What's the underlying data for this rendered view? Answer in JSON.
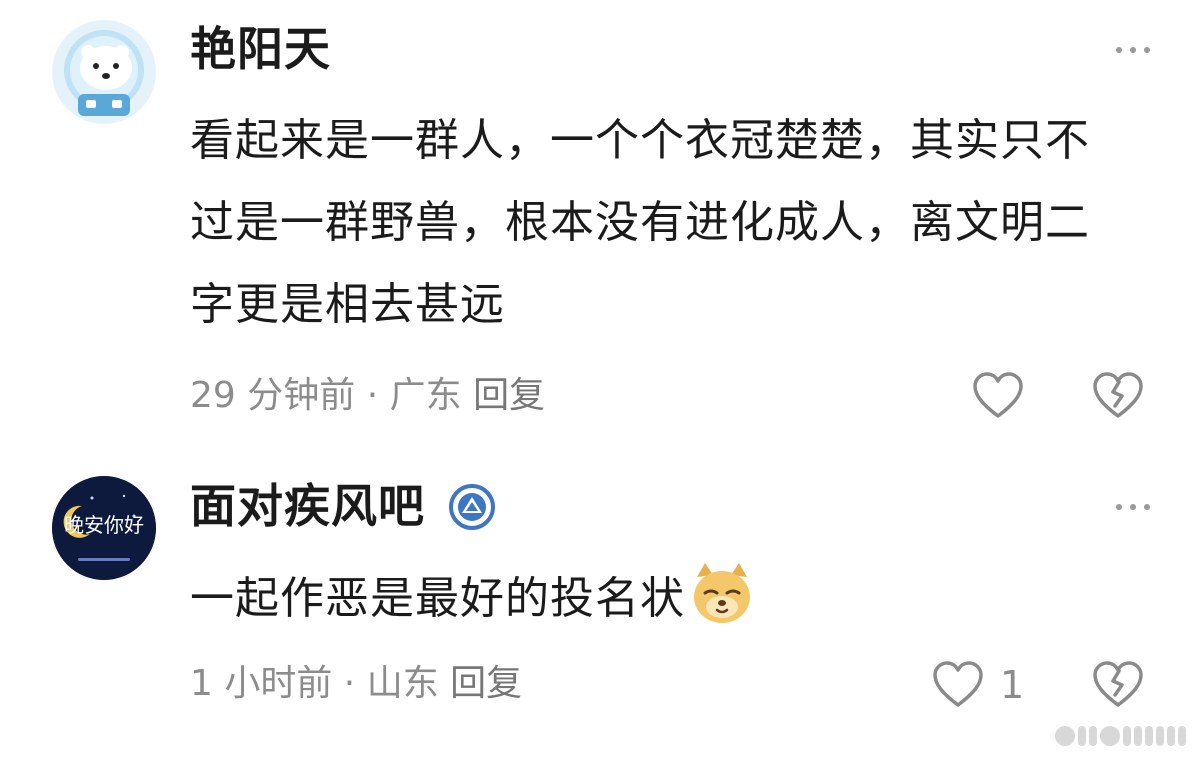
{
  "comments": [
    {
      "username": "艳阳天",
      "content": "看起来是一群人，一个个衣冠楚楚，其实只不过是一群野兽，根本没有进化成人，离文明二字更是相去甚远",
      "time": "29 分钟前",
      "location": "广东",
      "reply_label": "回复",
      "like_count": "",
      "avatar_icon": "polar-bear-astronaut-avatar",
      "colors": {
        "avatar_bg": "#eaf4fb"
      }
    },
    {
      "username": "面对疾风吧",
      "content": "一起作恶是最好的投名状",
      "emoji": "doge-emoji",
      "time": "1 小时前",
      "location": "山东",
      "reply_label": "回复",
      "like_count": "1",
      "avatar_icon": "good-night-avatar",
      "avatar_text": "晚安你好",
      "badge_icon": "member-badge-icon",
      "colors": {
        "avatar_bg": "#0d1a3d",
        "badge": "#3f76c2"
      }
    }
  ],
  "meta_separator": " · ",
  "watermark": "weibo-watermark"
}
